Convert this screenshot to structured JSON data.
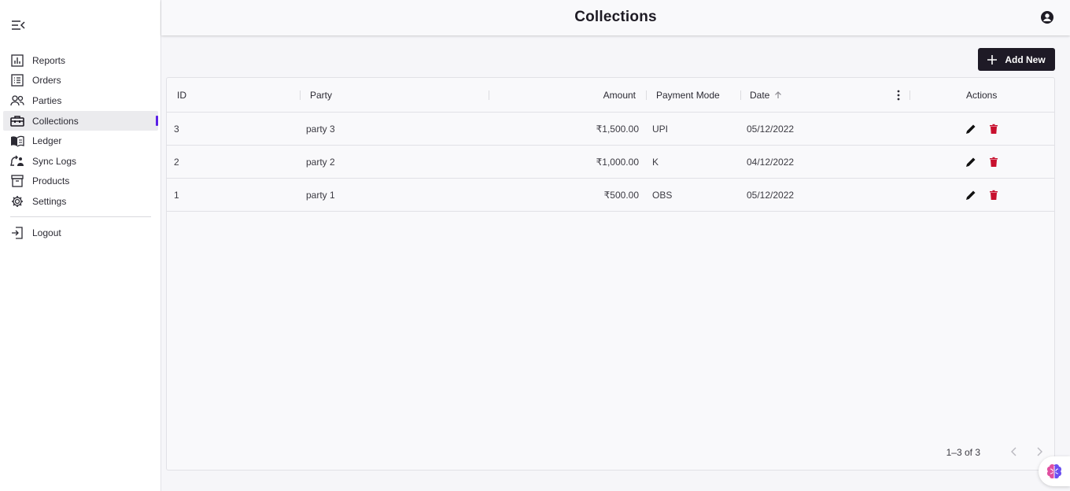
{
  "header": {
    "title": "Collections"
  },
  "sidebar": {
    "items": [
      {
        "label": "Reports",
        "icon": "bar-chart-icon"
      },
      {
        "label": "Orders",
        "icon": "list-icon"
      },
      {
        "label": "Parties",
        "icon": "people-icon"
      },
      {
        "label": "Collections",
        "icon": "toolbox-icon",
        "active": true
      },
      {
        "label": "Ledger",
        "icon": "book-icon"
      },
      {
        "label": "Sync Logs",
        "icon": "sync-icon"
      },
      {
        "label": "Products",
        "icon": "archive-icon"
      },
      {
        "label": "Settings",
        "icon": "gear-icon"
      }
    ],
    "logout": {
      "label": "Logout",
      "icon": "logout-icon"
    }
  },
  "toolbar": {
    "add_label": "Add New"
  },
  "table": {
    "columns": {
      "id": "ID",
      "party": "Party",
      "amount": "Amount",
      "payment_mode": "Payment Mode",
      "date": "Date",
      "actions": "Actions"
    },
    "rows": [
      {
        "id": "3",
        "party": "party 3",
        "amount": "₹1,500.00",
        "payment_mode": "UPI",
        "date": "05/12/2022"
      },
      {
        "id": "2",
        "party": "party 2",
        "amount": "₹1,000.00",
        "payment_mode": "K",
        "date": "04/12/2022"
      },
      {
        "id": "1",
        "party": "party 1",
        "amount": "₹500.00",
        "payment_mode": "OBS",
        "date": "05/12/2022"
      }
    ],
    "pagination": "1–3 of 3"
  },
  "colors": {
    "accent": "#5b21e6",
    "button_bg": "#1e1a26",
    "delete": "#c8102e"
  }
}
